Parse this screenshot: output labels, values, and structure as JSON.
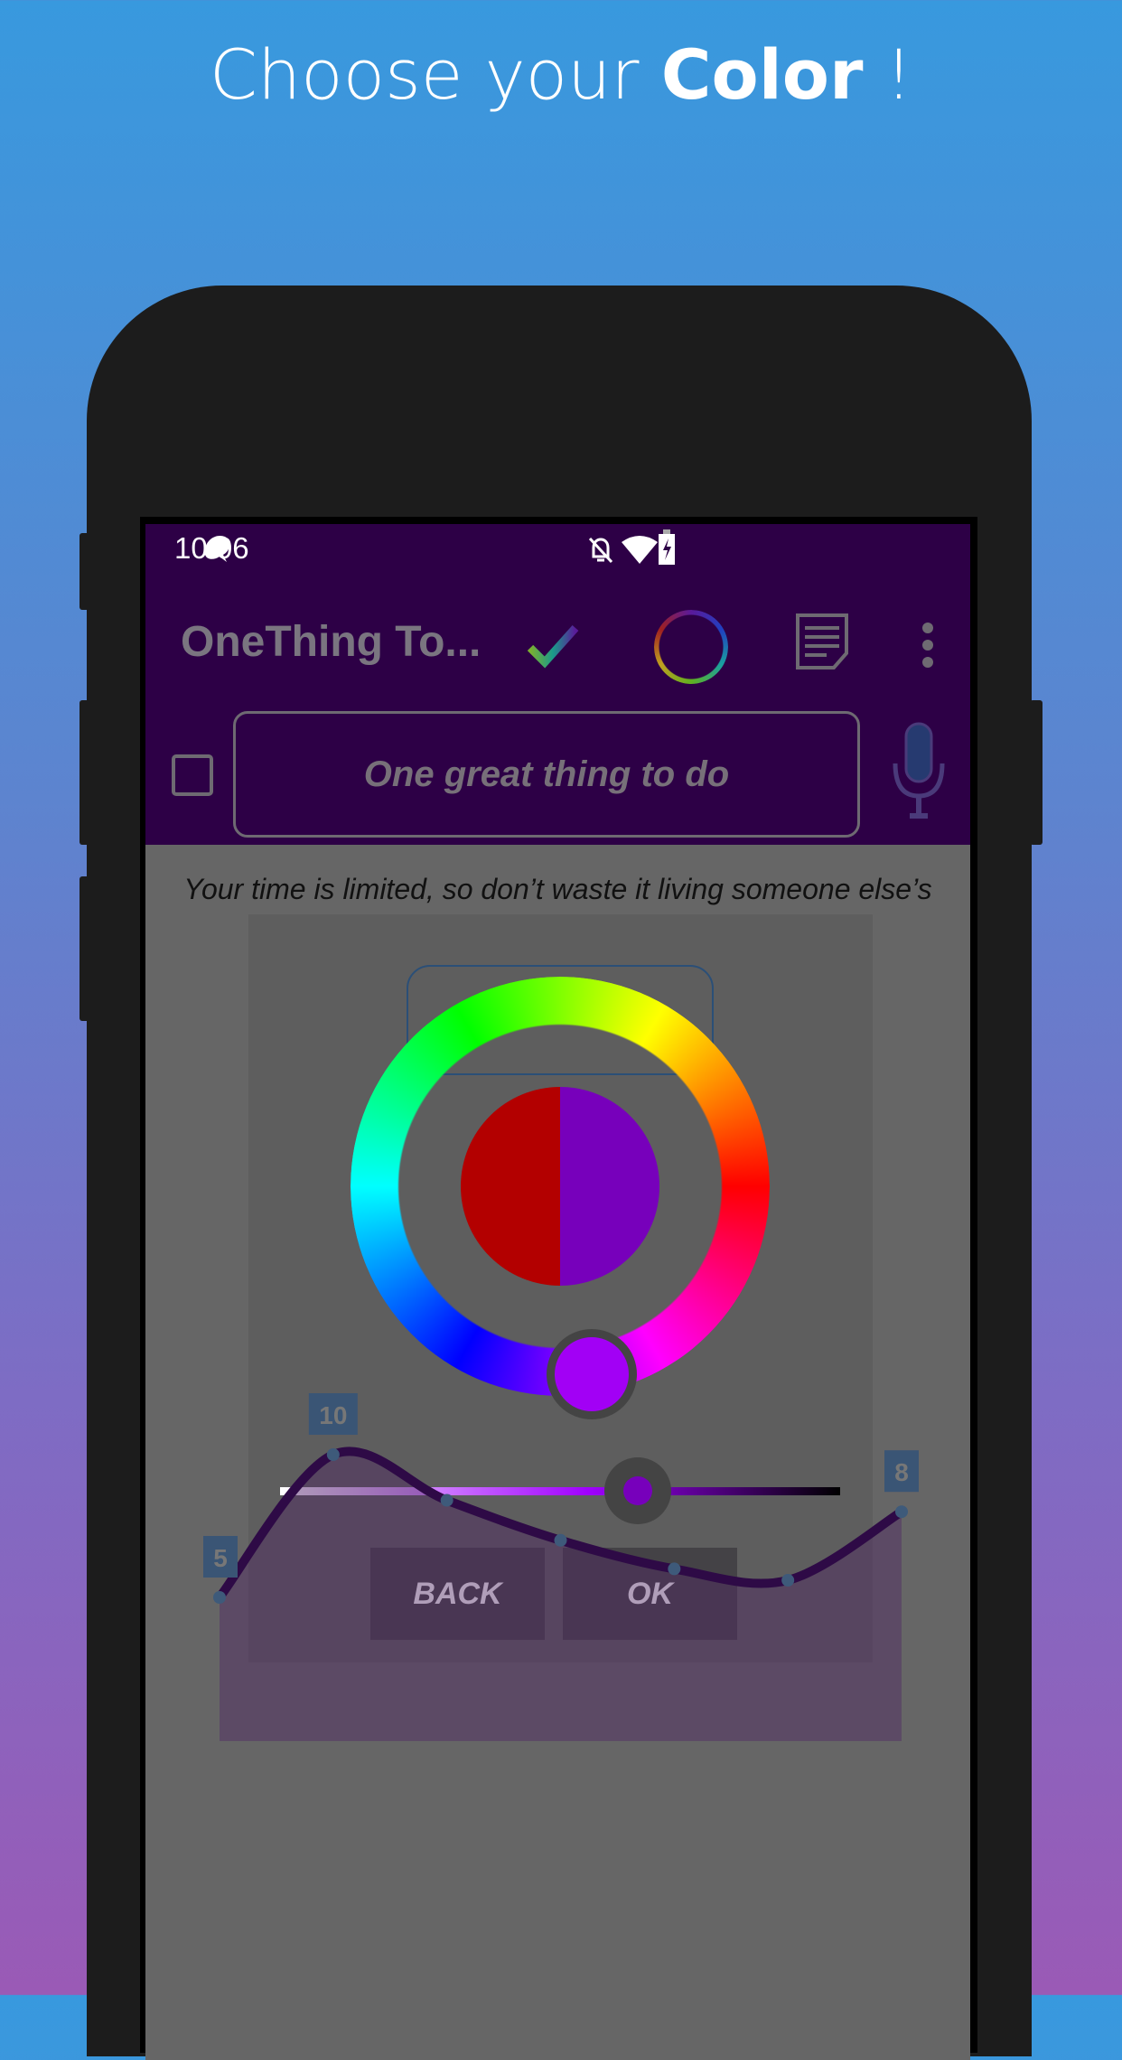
{
  "headline": {
    "prefix": "Choose your ",
    "bold": "Color",
    "suffix": " !"
  },
  "status_bar": {
    "time": "10:06",
    "icons": [
      "app-notification-icon",
      "bell-off-icon",
      "wifi-icon",
      "battery-charging-icon"
    ]
  },
  "app_bar": {
    "title": "OneThing To...",
    "actions": [
      "check-icon",
      "color-ring-icon",
      "notes-icon",
      "more-vert-icon"
    ]
  },
  "task": {
    "placeholder": "One great thing to do",
    "checked": false
  },
  "quote": "Your time is limited, so don’t waste it living someone else’s life. ~ Steve Jobs",
  "color_picker": {
    "old_color": "#b30000",
    "new_color": "#7700bb",
    "hue_selected": "#a200f5",
    "brightness_percent": 55,
    "back_label": "BACK",
    "ok_label": "OK"
  },
  "chart_data": {
    "type": "area",
    "values": [
      5,
      10,
      8.4,
      7,
      6,
      5.6,
      8
    ],
    "labels": [
      "5",
      "10",
      "",
      "",
      "",
      "",
      "8"
    ],
    "line_color": "#2e0a46"
  }
}
